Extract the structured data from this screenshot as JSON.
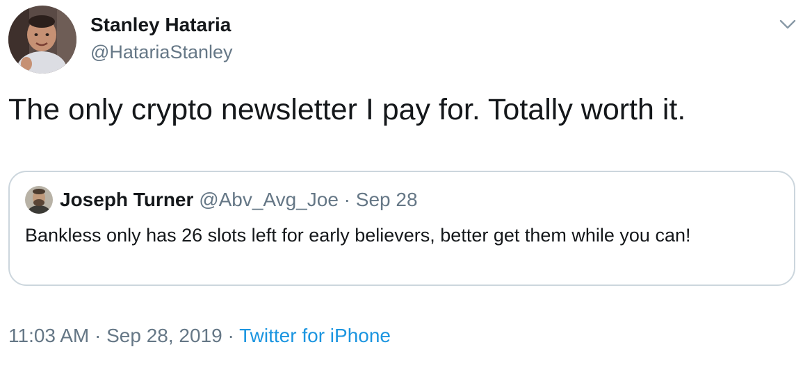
{
  "tweet": {
    "author": {
      "name": "Stanley Hataria",
      "handle": "@HatariaStanley"
    },
    "text": "The only crypto newsletter I pay for. Totally worth it.",
    "menu_icon": "chevron-down-icon",
    "quoted": {
      "name": "Joseph Turner",
      "handle": "@Abv_Avg_Joe",
      "separator": "·",
      "date": "Sep 28",
      "text": "Bankless only has 26 slots left for early believers, better get them while you can!"
    },
    "meta": {
      "time": "11:03 AM",
      "separator1": "·",
      "date": "Sep 28, 2019",
      "separator2": "·",
      "source": "Twitter for iPhone"
    }
  },
  "colors": {
    "text_primary": "#14171a",
    "text_secondary": "#657786",
    "link": "#1b95e0",
    "border": "#ccd6dd"
  }
}
